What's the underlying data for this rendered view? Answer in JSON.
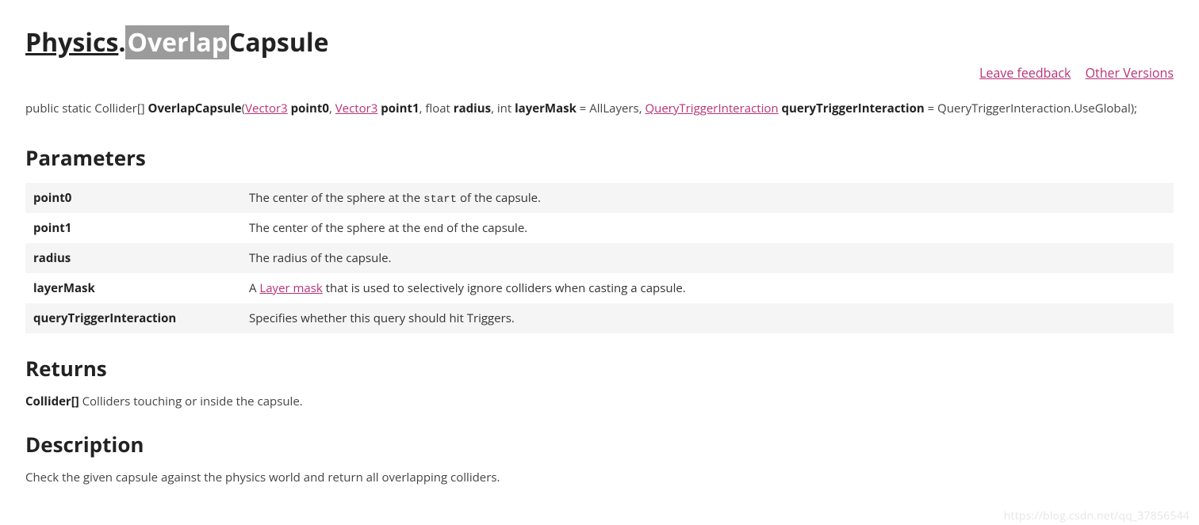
{
  "title": {
    "class": "Physics",
    "dot": ".",
    "highlight": "Overlap",
    "suffix": "Capsule"
  },
  "topLinks": {
    "feedback": "Leave feedback",
    "otherVersions": "Other Versions"
  },
  "signature": {
    "prefix": "public static Collider[] ",
    "method": "OverlapCapsule",
    "open": "(",
    "type1": "Vector3",
    "p1": " point0",
    "sep1": ", ",
    "type2": "Vector3",
    "p2": " point1",
    "sep2": ", float ",
    "p3": "radius",
    "sep3": ", int ",
    "p4": "layerMask",
    "def4": " = AllLayers, ",
    "type5": "QueryTriggerInteraction",
    "p5": " queryTriggerInteraction",
    "def5": " = QueryTriggerInteraction.UseGlobal);"
  },
  "sections": {
    "parameters": "Parameters",
    "returns": "Returns",
    "description": "Description"
  },
  "params": [
    {
      "name": "point0",
      "desc_pre": "The center of the sphere at the ",
      "code": "start",
      "desc_post": " of the capsule."
    },
    {
      "name": "point1",
      "desc_pre": "The center of the sphere at the ",
      "code": "end",
      "desc_post": " of the capsule."
    },
    {
      "name": "radius",
      "desc_pre": "The radius of the capsule.",
      "code": "",
      "desc_post": ""
    },
    {
      "name": "layerMask",
      "desc_pre": "A ",
      "link": "Layer mask",
      "desc_post": " that is used to selectively ignore colliders when casting a capsule."
    },
    {
      "name": "queryTriggerInteraction",
      "desc_pre": "Specifies whether this query should hit Triggers.",
      "code": "",
      "desc_post": ""
    }
  ],
  "returns": {
    "type": "Collider[]",
    "text": " Colliders touching or inside the capsule."
  },
  "description": "Check the given capsule against the physics world and return all overlapping colliders.",
  "watermark": "https://blog.csdn.net/qq_37856544"
}
